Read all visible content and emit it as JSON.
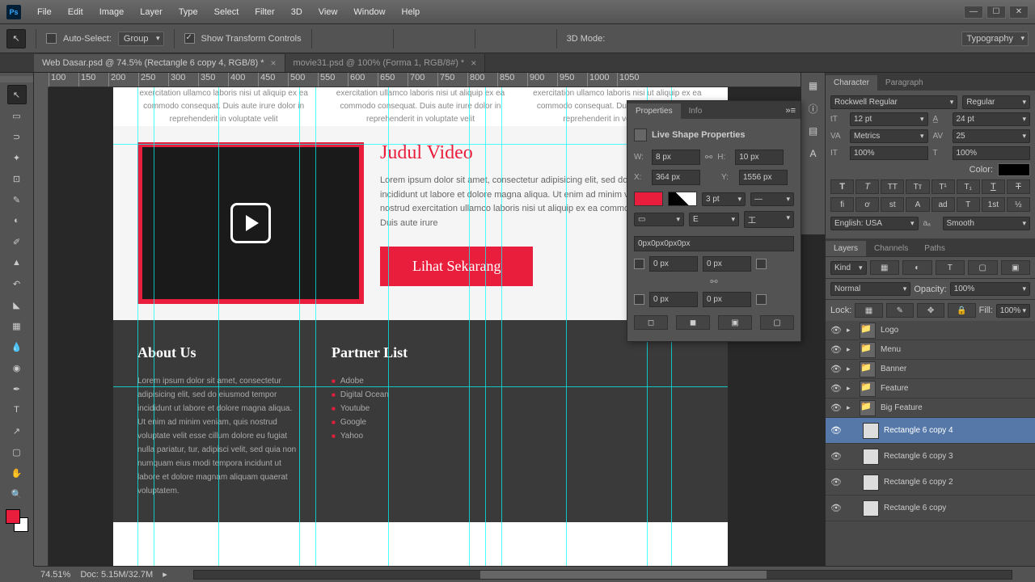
{
  "app": {
    "name": "Ps"
  },
  "menu": [
    "File",
    "Edit",
    "Image",
    "Layer",
    "Type",
    "Select",
    "Filter",
    "3D",
    "View",
    "Window",
    "Help"
  ],
  "options": {
    "auto_select": "Auto-Select:",
    "group": "Group",
    "show_transform": "Show Transform Controls",
    "mode_label": "3D Mode:",
    "typography": "Typography"
  },
  "tabs": [
    {
      "label": "Web Dasar.psd @ 74.5% (Rectangle 6 copy 4, RGB/8) *",
      "active": true
    },
    {
      "label": "movie31.psd @ 100% (Forma 1, RGB/8#) *",
      "active": false
    }
  ],
  "ruler": [
    "100",
    "150",
    "200",
    "250",
    "300",
    "350",
    "400",
    "450",
    "500",
    "550",
    "600",
    "650",
    "700",
    "750",
    "800",
    "850",
    "900",
    "950",
    "1000",
    "1050"
  ],
  "doc": {
    "lorem_col": "exercitation ullamco laboris nisi ut aliquip ex ea commodo consequat. Duis aute irure dolor in reprehenderit in voluptate velit",
    "video_title": "Judul Video",
    "video_desc": "Lorem ipsum dolor sit amet, consectetur adipisicing elit, sed do eiusmod tempor incididunt ut labore et dolore magna aliqua. Ut enim ad minim veniam, quis nostrud exercitation ullamco laboris nisi ut aliquip ex ea commodo consequat. Duis aute irure",
    "cta": "Lihat Sekarang",
    "about_title": "About Us",
    "about_text": "Lorem ipsum dolor sit amet, consectetur adipisicing elit, sed do eiusmod tempor incididunt ut labore et dolore magna aliqua. Ut enim ad minim veniam, quis nostrud voluptate velit esse cillum dolore eu fugiat nulla pariatur, tur, adipisci velit, sed quia non numquam eius modi tempora incidunt ut labore et dolore magnam aliquam quaerat voluptatem.",
    "partner_title": "Partner List",
    "partners": [
      "Adobe",
      "Digital Ocean",
      "Youtube",
      "Google",
      "Yahoo"
    ]
  },
  "properties": {
    "tab1": "Properties",
    "tab2": "Info",
    "title": "Live Shape Properties",
    "w": "8 px",
    "h": "10 px",
    "x": "364 px",
    "y": "1556 px",
    "stroke": "3 pt",
    "corners_text": "0px0px0px0px",
    "c1": "0 px",
    "c2": "0 px",
    "c3": "0 px",
    "c4": "0 px",
    "fill_color": "#e91e3c"
  },
  "character": {
    "tab1": "Character",
    "tab2": "Paragraph",
    "font": "Rockwell Regular",
    "style": "Regular",
    "size": "12 pt",
    "leading": "24 pt",
    "kerning": "Metrics",
    "tracking": "25",
    "vscale": "100%",
    "hscale": "100%",
    "color_label": "Color:",
    "lang": "English: USA",
    "aa": "Smooth"
  },
  "layers_panel": {
    "tab1": "Layers",
    "tab2": "Channels",
    "tab3": "Paths",
    "kind": "Kind",
    "blend": "Normal",
    "opacity_label": "Opacity:",
    "opacity": "100%",
    "lock_label": "Lock:",
    "fill_label": "Fill:",
    "fill": "100%",
    "items": [
      {
        "name": "Logo",
        "type": "group"
      },
      {
        "name": "Menu",
        "type": "group"
      },
      {
        "name": "Banner",
        "type": "group"
      },
      {
        "name": "Feature",
        "type": "group"
      },
      {
        "name": "Big Feature",
        "type": "group"
      },
      {
        "name": "Rectangle 6 copy 4",
        "type": "shape",
        "selected": true
      },
      {
        "name": "Rectangle 6 copy 3",
        "type": "shape"
      },
      {
        "name": "Rectangle 6 copy 2",
        "type": "shape"
      },
      {
        "name": "Rectangle 6 copy",
        "type": "shape"
      }
    ]
  },
  "status": {
    "zoom": "74.51%",
    "doc": "Doc: 5.15M/32.7M"
  }
}
